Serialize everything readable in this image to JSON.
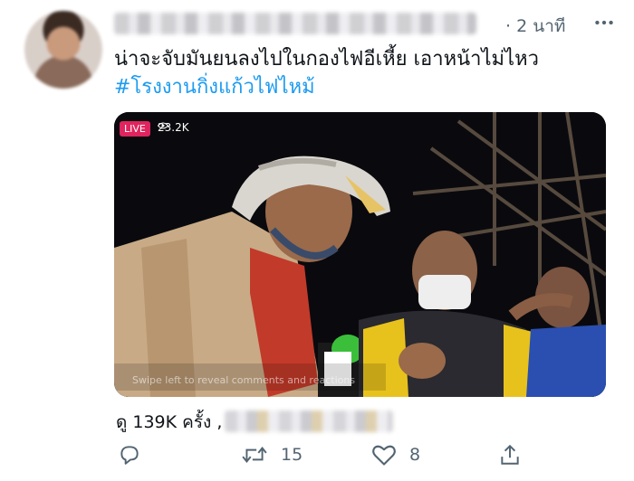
{
  "tweet": {
    "time": "· 2 นาที",
    "text_line1": "น่าจะจับมันยนลงไปในกองไฟอีเหี้ย เอาหน้าไม่ไหว",
    "hashtag": "#โรงงานกิ่งแก้วไฟไหม้"
  },
  "media": {
    "live_label": "LIVE",
    "viewer_count": "23.2K",
    "caption_overlay": "Swipe left to reveal comments and reactions"
  },
  "stats": {
    "views": "ดู 139K ครั้ง ,"
  },
  "actions": {
    "retweets": "15",
    "likes": "8"
  },
  "colors": {
    "link": "#1d9bf0",
    "secondary": "#536471",
    "live": "#e0245e"
  },
  "icons": {
    "more": "ellipsis-icon",
    "reply": "reply-icon",
    "retweet": "retweet-icon",
    "like": "heart-icon",
    "share": "share-icon"
  }
}
